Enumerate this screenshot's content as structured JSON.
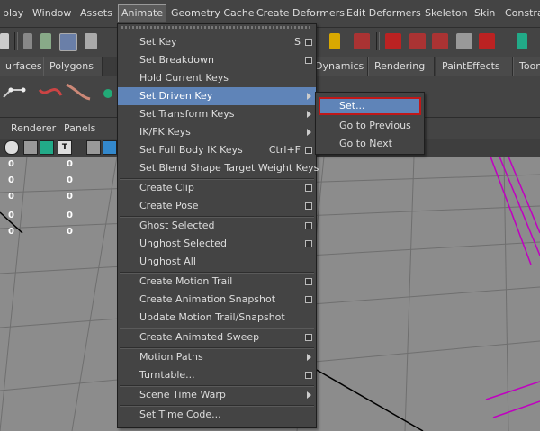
{
  "menubar": {
    "items": [
      "play",
      "Window",
      "Assets",
      "Animate",
      "Geometry Cache",
      "Create Deformers",
      "Edit Deformers",
      "Skeleton",
      "Skin",
      "Constra"
    ],
    "active": "Animate"
  },
  "shelf_tabs": [
    "urfaces",
    "Polygons",
    "Dynamics",
    "Rendering",
    "PaintEffects",
    "Toon"
  ],
  "panel_menus": [
    "Renderer",
    "Panels"
  ],
  "viewport": {
    "channel_values": [
      "0",
      "0",
      "0",
      "0",
      "0",
      "0",
      "0",
      "0",
      "0",
      "0",
      "0",
      "0"
    ]
  },
  "animate_menu": {
    "items": [
      {
        "label": "Set Key",
        "shortcut": "S",
        "option_box": true
      },
      {
        "label": "Set Breakdown",
        "option_box": true
      },
      {
        "label": "Hold Current Keys"
      },
      {
        "label": "Set Driven Key",
        "submenu": true,
        "highlighted": true
      },
      {
        "label": "Set Transform Keys",
        "submenu": true
      },
      {
        "label": "IK/FK Keys",
        "submenu": true
      },
      {
        "label": "Set Full Body IK Keys",
        "shortcut": "Ctrl+F",
        "option_box": true
      },
      {
        "label": "Set Blend Shape Target Weight Keys"
      },
      {
        "label": "Create Clip",
        "option_box": true
      },
      {
        "label": "Create Pose",
        "option_box": true
      },
      {
        "label": "Ghost Selected",
        "option_box": true
      },
      {
        "label": "Unghost Selected",
        "option_box": true
      },
      {
        "label": "Unghost All"
      },
      {
        "label": "Create Motion Trail",
        "option_box": true
      },
      {
        "label": "Create Animation Snapshot",
        "option_box": true
      },
      {
        "label": "Update Motion Trail/Snapshot"
      },
      {
        "label": "Create Animated Sweep",
        "option_box": true
      },
      {
        "label": "Motion Paths",
        "submenu": true
      },
      {
        "label": "Turntable...",
        "option_box": true
      },
      {
        "label": "Scene Time Warp",
        "submenu": true
      },
      {
        "label": "Set Time Code..."
      }
    ]
  },
  "set_driven_key_submenu": {
    "items": [
      "Set...",
      "Go to Previous",
      "Go to Next"
    ],
    "highlighted": "Set..."
  },
  "colors": {
    "menu_bg": "#444444",
    "highlight": "#5f84b8",
    "callout_red": "#c01818",
    "curve_magenta": "#c000c0",
    "viewport_bg": "#8c8c8c"
  }
}
